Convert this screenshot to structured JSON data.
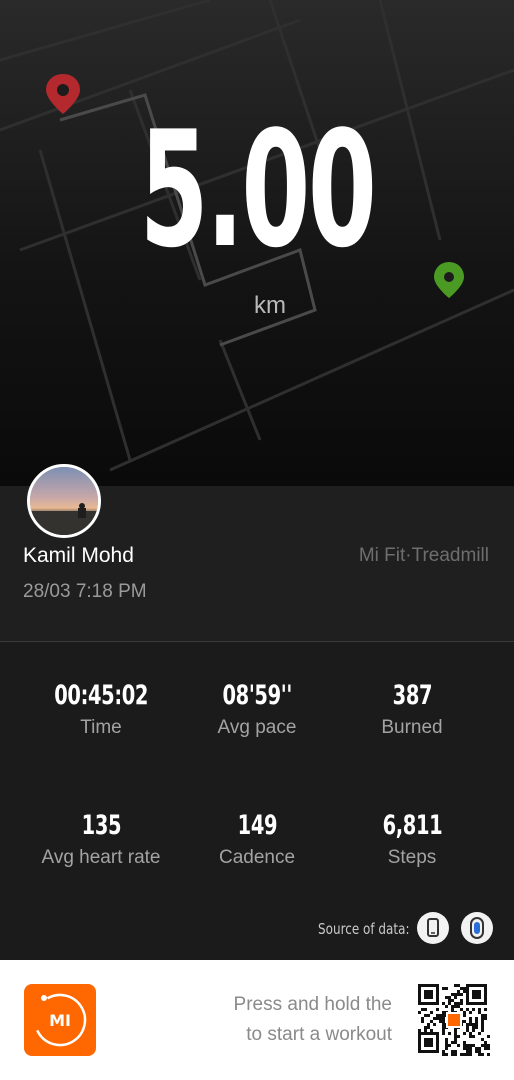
{
  "summary": {
    "distance": "5.00",
    "unit": "km"
  },
  "profile": {
    "name": "Kamil Mohd",
    "datetime": "28/03 7:18 PM",
    "source_app": "Mi Fit·Treadmill"
  },
  "stats": [
    {
      "value": "00:45:02",
      "label": "Time"
    },
    {
      "value": "08'59''",
      "label": "Avg pace"
    },
    {
      "value": "387",
      "label": "Burned"
    },
    {
      "value": "135",
      "label": "Avg heart rate"
    },
    {
      "value": "149",
      "label": "Cadence"
    },
    {
      "value": "6,811",
      "label": "Steps"
    }
  ],
  "source": {
    "label": "Source of data:",
    "icons": [
      "phone-icon",
      "watch-icon"
    ]
  },
  "footer": {
    "promo_line1": "Press and hold the",
    "promo_line2": "to start a workout",
    "app_logo_text": "MI",
    "icons": [
      "mi-fit-app-icon",
      "qr-code-icon"
    ]
  },
  "colors": {
    "accent": "#ff6700",
    "start_pin": "#b3292e",
    "end_pin": "#4b9a23"
  }
}
